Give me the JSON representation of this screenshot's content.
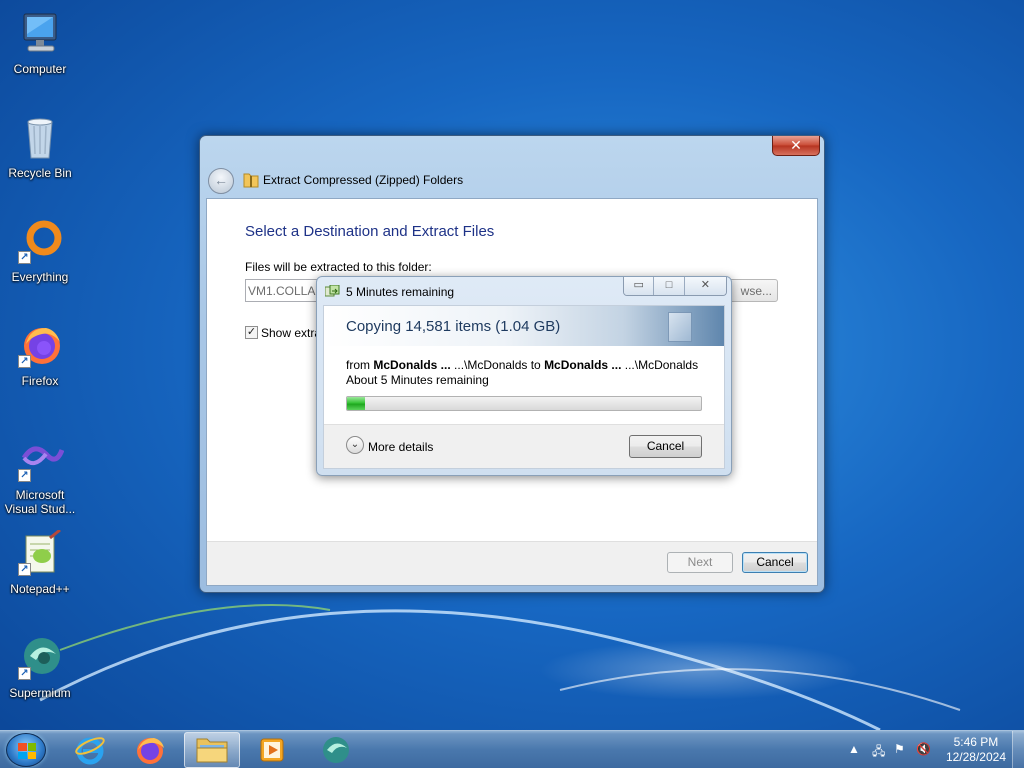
{
  "desktop": {
    "icons": [
      {
        "label": "Computer",
        "icon": "computer-icon"
      },
      {
        "label": "Recycle Bin",
        "icon": "recycle-bin-icon"
      },
      {
        "label": "Everything",
        "icon": "everything-icon"
      },
      {
        "label": "Firefox",
        "icon": "firefox-icon"
      },
      {
        "label": "Microsoft Visual Stud...",
        "icon": "visual-studio-icon"
      },
      {
        "label": "Notepad++",
        "icon": "notepad-plus-plus-icon"
      },
      {
        "label": "Supermium",
        "icon": "supermium-icon"
      }
    ]
  },
  "wizard": {
    "title": "Extract Compressed (Zipped) Folders",
    "close_label": "✕",
    "heading": "Select a Destination and Extract Files",
    "folder_label": "Files will be extracted to this folder:",
    "folder_path": "VM1.COLLAB",
    "browse_label": "wse...",
    "show_files_label": "Show extra",
    "show_files_checked": true,
    "next_label": "Next",
    "cancel_label": "Cancel"
  },
  "copy_dialog": {
    "title": "5 Minutes remaining",
    "heading": "Copying 14,581 items (1.04 GB)",
    "from_prefix": "from ",
    "from_name": "McDonalds ...",
    "from_path": " ...\\McDonalds to ",
    "to_name": "McDonalds ...",
    "to_path": " ...\\McDonalds",
    "remaining": "About 5 Minutes remaining",
    "progress_fraction": 0.05,
    "more_details_label": "More details",
    "cancel_label": "Cancel"
  },
  "taskbar": {
    "apps": [
      {
        "name": "internet-explorer",
        "active": false
      },
      {
        "name": "firefox",
        "active": false
      },
      {
        "name": "file-explorer",
        "active": true
      },
      {
        "name": "media-player",
        "active": false
      },
      {
        "name": "supermium",
        "active": false
      }
    ],
    "time": "5:46 PM",
    "date": "12/28/2024"
  },
  "colors": {
    "accent_heading": "#1e3287",
    "progress_green": "#37c437",
    "close_red": "#c94a34"
  }
}
